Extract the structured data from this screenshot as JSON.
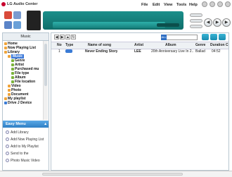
{
  "app": {
    "title": "LG Audio Center"
  },
  "menu": [
    "File",
    "Edit",
    "View",
    "Tools",
    "Help"
  ],
  "sidebar": {
    "header": "Music",
    "tree": [
      {
        "label": "Home",
        "level": 0,
        "color": "#f0a43a"
      },
      {
        "label": "Now Playing List",
        "level": 0,
        "color": "#f0a43a"
      },
      {
        "label": "Library",
        "level": 0,
        "color": "#f0a43a"
      },
      {
        "label": "Music",
        "level": 1,
        "color": "#f0a43a",
        "selected": true
      },
      {
        "label": "Genre",
        "level": 2,
        "color": "#7bb33a"
      },
      {
        "label": "Artist",
        "level": 2,
        "color": "#7bb33a"
      },
      {
        "label": "Purchased mu",
        "level": 2,
        "color": "#7bb33a"
      },
      {
        "label": "File type",
        "level": 2,
        "color": "#7bb33a"
      },
      {
        "label": "Album",
        "level": 2,
        "color": "#7bb33a"
      },
      {
        "label": "File location",
        "level": 2,
        "color": "#7bb33a"
      },
      {
        "label": "Video",
        "level": 1,
        "color": "#f0a43a"
      },
      {
        "label": "Photo",
        "level": 1,
        "color": "#f0a43a"
      },
      {
        "label": "Document",
        "level": 1,
        "color": "#f0a43a"
      },
      {
        "label": "My playlist",
        "level": 0,
        "color": "#f0a43a"
      },
      {
        "label": "Drive J Device",
        "level": 0,
        "color": "#3a7bd5"
      }
    ]
  },
  "easy_menu": {
    "title": "Easy Menu",
    "items": [
      "Add Library",
      "Add Now Playing List",
      "Add to My Playlist",
      "Send to the",
      "Photo Music Video"
    ]
  },
  "main": {
    "search_button": "ALL",
    "columns": [
      "No",
      "Type",
      "Name of song",
      "Artist",
      "Album",
      "Genre",
      "Duration C"
    ],
    "rows": [
      {
        "no": "1",
        "name": "Never Ending Story",
        "artist": "LEE",
        "album": "20th Anniversary Live In 2...",
        "genre": "Ballad",
        "duration": "04:52"
      }
    ]
  },
  "colors": {
    "accent": "#1b8f8b",
    "selection": "#3b78d8",
    "easy_header": "#2f7fc4"
  }
}
